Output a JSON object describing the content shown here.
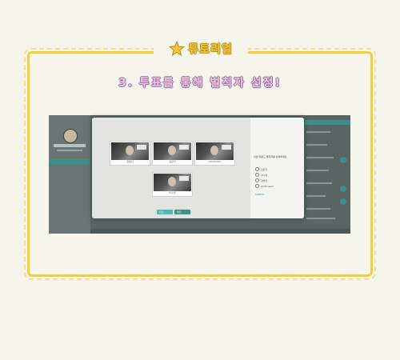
{
  "header": {
    "title": "튜토리얼",
    "step_heading": "3. 투표를 통해 벌칙자 선정!"
  },
  "modal": {
    "participants": [
      {
        "name": "정호신"
      },
      {
        "name": "김은지"
      },
      {
        "name": "tmdTnwkd"
      },
      {
        "name": "이수정"
      }
    ],
    "question": "이번 라운드 벌칙자를 선택하세요",
    "options": [
      "김은지",
      "이수정",
      "정호신",
      "tmdTnwkd"
    ],
    "submit_label": "SUBMIT",
    "buttons": [
      "취소",
      "확인"
    ]
  },
  "colors": {
    "frame": "#f4cf3c",
    "title_text": "#f3c93a",
    "heading_text": "#f3c4d2",
    "accent_teal": "#3e8e8a",
    "background": "#f6f5ec"
  },
  "icons": {
    "title_icon": "star-icon"
  }
}
